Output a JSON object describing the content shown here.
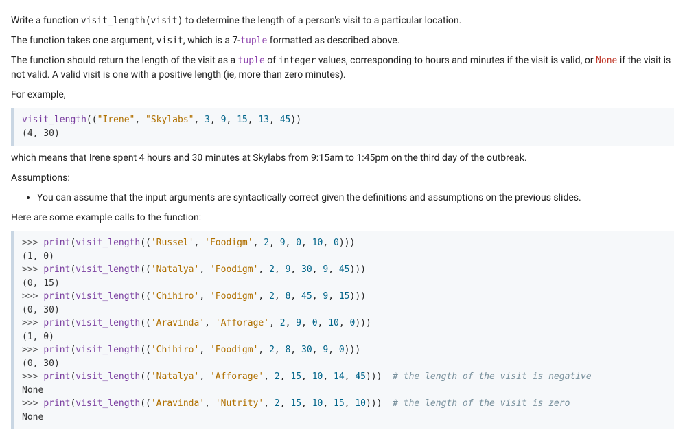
{
  "p1_a": "Write a function ",
  "p1_code": "visit_length(visit)",
  "p1_b": " to determine the length of a person's visit to a particular location.",
  "p2_a": "The function takes one argument, ",
  "p2_code": "visit",
  "p2_b": ", which is a 7-",
  "p2_tuple": "tuple",
  "p2_c": " formatted as described above.",
  "p3_a": "The function should return the length of the visit as a ",
  "p3_tuple": "tuple",
  "p3_b": " of ",
  "p3_int": "integer",
  "p3_c": " values, corresponding to hours and minutes if the visit is valid, or ",
  "p3_none": "None",
  "p3_d": " if the visit is not valid. A valid visit is one with a positive length (ie, more than zero minutes).",
  "p4": "For example,",
  "ex1": {
    "fn": "visit_length",
    "args": [
      "\"Irene\"",
      "\"Skylabs\"",
      "3",
      "9",
      "15",
      "13",
      "45"
    ],
    "out": "(4, 30)"
  },
  "p5": "which means that Irene spent 4 hours and 30 minutes at Skylabs from 9:15am to 1:45pm on the third day of the outbreak.",
  "assumptions_heading": "Assumptions:",
  "assumption_item": "You can assume that the input arguments are syntactically correct given the definitions and assumptions on the previous slides.",
  "p_examples": "Here are some example calls to the function:",
  "console": {
    "prompt": ">>>",
    "print": "print",
    "fn": "visit_length",
    "lines": [
      {
        "args": [
          "'Russel'",
          "'Foodigm'",
          "2",
          "9",
          "0",
          "10",
          "0"
        ],
        "out": "(1, 0)",
        "comment": ""
      },
      {
        "args": [
          "'Natalya'",
          "'Foodigm'",
          "2",
          "9",
          "30",
          "9",
          "45"
        ],
        "out": "(0, 15)",
        "comment": ""
      },
      {
        "args": [
          "'Chihiro'",
          "'Foodigm'",
          "2",
          "8",
          "45",
          "9",
          "15"
        ],
        "out": "(0, 30)",
        "comment": ""
      },
      {
        "args": [
          "'Aravinda'",
          "'Afforage'",
          "2",
          "9",
          "0",
          "10",
          "0"
        ],
        "out": "(1, 0)",
        "comment": ""
      },
      {
        "args": [
          "'Chihiro'",
          "'Foodigm'",
          "2",
          "8",
          "30",
          "9",
          "0"
        ],
        "out": "(0, 30)",
        "comment": ""
      },
      {
        "args": [
          "'Natalya'",
          "'Afforage'",
          "2",
          "15",
          "10",
          "14",
          "45"
        ],
        "out": "None",
        "comment": "# the length of the visit is negative"
      },
      {
        "args": [
          "'Aravinda'",
          "'Nutrity'",
          "2",
          "15",
          "10",
          "15",
          "10"
        ],
        "out": "None",
        "comment": "# the length of the visit is zero"
      }
    ]
  }
}
